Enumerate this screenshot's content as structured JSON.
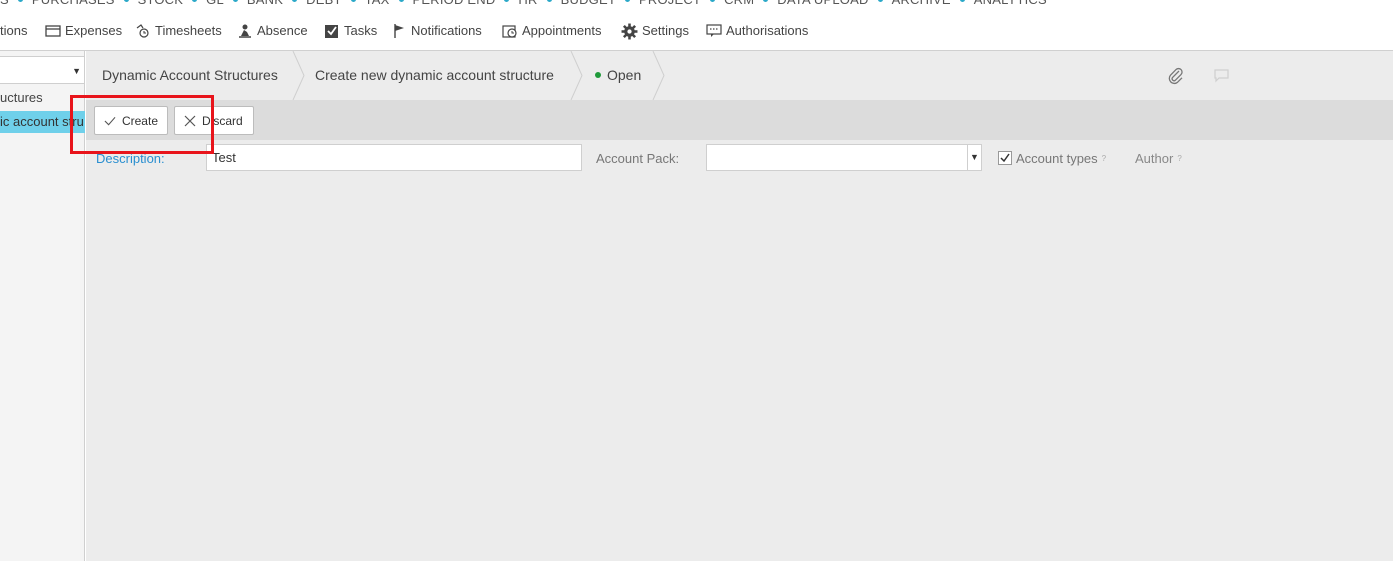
{
  "modules": [
    "S",
    "PURCHASES",
    "STOCK",
    "GL",
    "BANK",
    "DEBT",
    "TAX",
    "PERIOD END",
    "HR",
    "BUDGET",
    "PROJECT",
    "CRM",
    "DATA UPLOAD",
    "ARCHIVE",
    "ANALYTICS"
  ],
  "subnav": {
    "tions": "tions",
    "expenses": "Expenses",
    "timesheets": "Timesheets",
    "absence": "Absence",
    "tasks": "Tasks",
    "notifications": "Notifications",
    "appointments": "Appointments",
    "settings": "Settings",
    "authorisations": "Authorisations"
  },
  "sidebar": {
    "select_value": "",
    "item1": "uctures",
    "item2": "ic account stru"
  },
  "breadcrumb": {
    "root": "Dynamic Account Structures",
    "current": "Create new dynamic account structure",
    "status": "Open"
  },
  "toolbar": {
    "create": "Create",
    "discard": "Discard"
  },
  "form": {
    "description_label": "Description:",
    "description_value": "Test",
    "account_pack_label": "Account Pack:",
    "account_pack_value": "",
    "account_types_label": "Account types",
    "account_types_checked": true,
    "author_label": "Author",
    "help_mark": "?"
  },
  "colors": {
    "accent": "#2aa8c8",
    "selected_sidebar": "#6fd0ea",
    "status_open": "#1f9a3a",
    "highlight": "#e8141b",
    "label_blue": "#2a8fd0"
  }
}
